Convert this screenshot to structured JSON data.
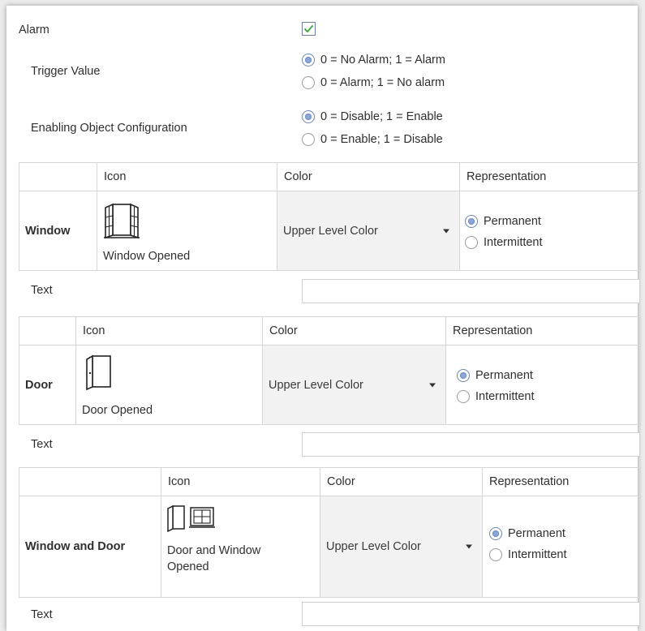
{
  "alarm": {
    "label": "Alarm",
    "checked": true
  },
  "trigger": {
    "label": "Trigger Value",
    "options": [
      "0 = No Alarm; 1 = Alarm",
      "0 = Alarm; 1 = No alarm"
    ],
    "selected": 0
  },
  "enabling": {
    "label": "Enabling Object Configuration",
    "options": [
      "0 = Disable; 1 = Enable",
      "0 = Enable; 1 = Disable"
    ],
    "selected": 0
  },
  "columns": {
    "icon": "Icon",
    "color": "Color",
    "representation": "Representation"
  },
  "rows": [
    {
      "name": "Window",
      "icon_name": "window-opened-icon",
      "icon_caption": "Window Opened",
      "color_value": "Upper Level Color",
      "rep_options": [
        "Permanent",
        "Intermittent"
      ],
      "rep_selected": 0,
      "text_label": "Text",
      "text_value": ""
    },
    {
      "name": "Door",
      "icon_name": "door-opened-icon",
      "icon_caption": "Door Opened",
      "color_value": "Upper Level Color",
      "rep_options": [
        "Permanent",
        "Intermittent"
      ],
      "rep_selected": 0,
      "text_label": "Text",
      "text_value": ""
    },
    {
      "name": "Window and Door",
      "icon_name": "door-and-window-opened-icon",
      "icon_caption": "Door and Window Opened",
      "color_value": "Upper Level Color",
      "rep_options": [
        "Permanent",
        "Intermittent"
      ],
      "rep_selected": 0,
      "text_label": "Text",
      "text_value": ""
    }
  ],
  "colors": {
    "checkmark": "#3aa63a",
    "radio_selected": "#8aa6d6",
    "dropdown_bg": "#f2f2f2",
    "border": "#d6d6d6"
  }
}
